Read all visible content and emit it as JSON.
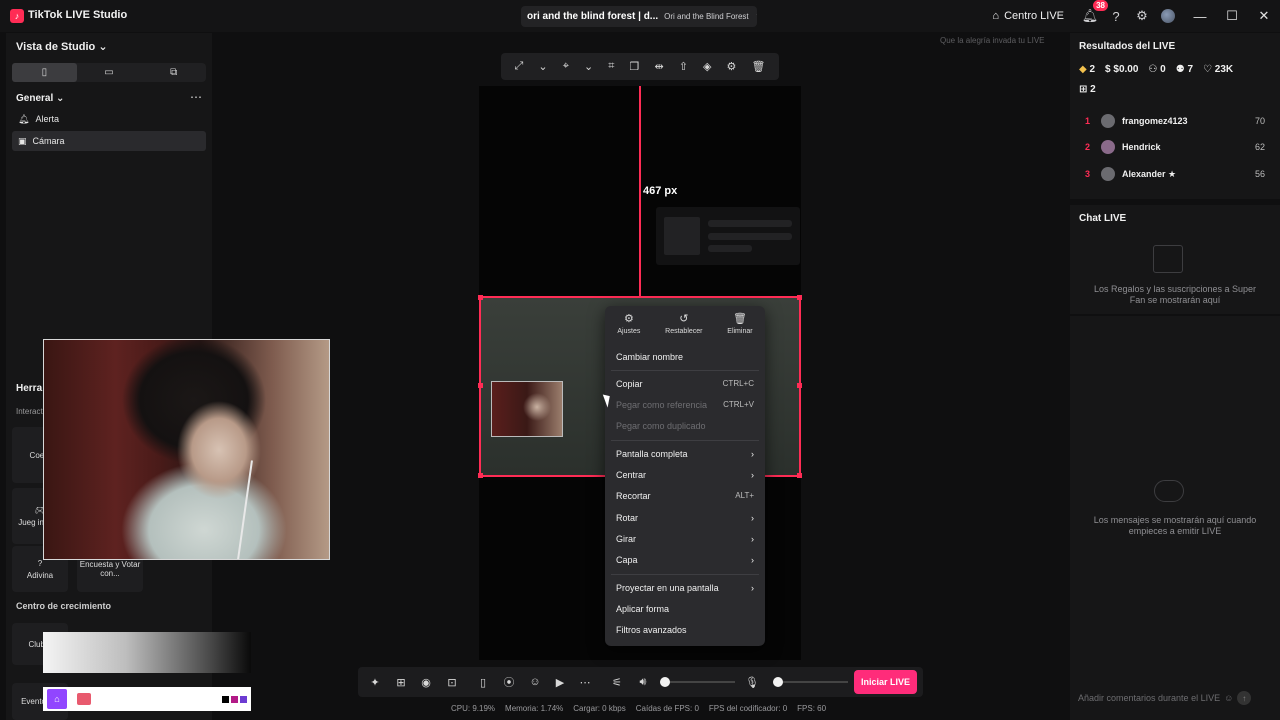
{
  "titlebar": {
    "app_title": "TikTok LIVE Studio",
    "game_title": "ori and the blind forest | d...",
    "game_subtitle": "Ori and the Blind Forest",
    "centro_live": "Centro LIVE",
    "notif_count": "38"
  },
  "left": {
    "studio_view": "Vista de Studio",
    "general": "General",
    "sources": [
      {
        "label": "Alerta",
        "icon": "bell-icon"
      },
      {
        "label": "Cámara",
        "icon": "camera-icon"
      }
    ],
    "tools_heading": "Herra",
    "interact_heading": "Interact",
    "tools": [
      {
        "label": "Coeni"
      },
      {
        "label": "Jueg interac"
      },
      {
        "label": "Adivina"
      },
      {
        "label": "Encuesta y Votar con..."
      }
    ],
    "growth_heading": "Centro de crecimiento",
    "growth_items": [
      {
        "label": "Club d"
      },
      {
        "label": "Eventos ..."
      }
    ]
  },
  "canvas": {
    "hint": "Que la alegría invada tu LIVE",
    "measure_label": "467 px"
  },
  "context_menu": {
    "top_actions": [
      {
        "label": "Ajustes",
        "icon": "settings-icon"
      },
      {
        "label": "Restablecer",
        "icon": "reset-icon"
      },
      {
        "label": "Eliminar",
        "icon": "trash-icon"
      }
    ],
    "rename": "Cambiar nombre",
    "copy": "Copiar",
    "copy_sc": "CTRL+C",
    "paste_ref": "Pegar como referencia",
    "paste_ref_sc": "CTRL+V",
    "paste_dup": "Pegar como duplicado",
    "fullscreen": "Pantalla completa",
    "center": "Centrar",
    "crop": "Recortar",
    "crop_sc": "ALT+",
    "rotate": "Rotar",
    "flip": "Girar",
    "layer": "Capa",
    "project": "Proyectar en una pantalla",
    "apply_form": "Aplicar forma",
    "filters": "Filtros avanzados"
  },
  "bottom": {
    "go_live": "Iniciar LIVE",
    "stats": {
      "cpu": "CPU: 9.19%",
      "mem": "Memoria: 1.74%",
      "load": "Cargar: 0 kbps",
      "fps_drop": "Caídas de FPS: 0",
      "enc_fps": "FPS del codificador: 0",
      "fps": "FPS: 60"
    }
  },
  "right": {
    "results_title": "Resultados del LIVE",
    "stat_diamonds": "2",
    "stat_money": "$0.00",
    "stat_viewers": "0",
    "stat_followers": "7",
    "stat_likes": "23K",
    "stat_gifts": "2",
    "ranking": [
      {
        "rank": "1",
        "name": "frangomez4123",
        "score": "70"
      },
      {
        "rank": "2",
        "name": "Hendrick",
        "score": "62"
      },
      {
        "rank": "3",
        "name": "Alexander ★",
        "score": "56"
      }
    ],
    "chat_title": "Chat LIVE",
    "gifts_empty": "Los Regalos y las suscripciones a Super Fan se mostrarán aquí",
    "chat_empty": "Los mensajes se mostrarán aquí cuando empieces a emitir LIVE",
    "chat_placeholder": "Añadir comentarios durante el LIVE"
  },
  "colors": {
    "accent": "#ff2c55",
    "go_live": "#ff2c7a"
  }
}
